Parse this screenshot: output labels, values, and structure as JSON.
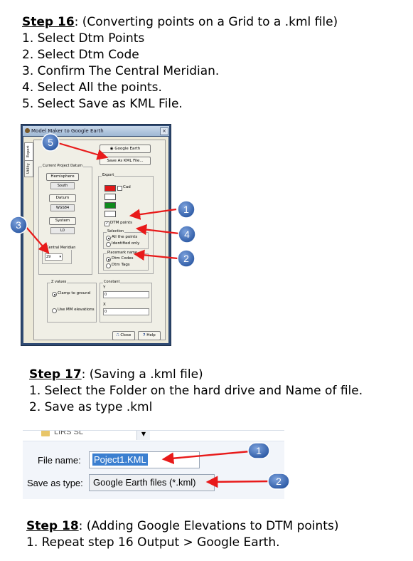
{
  "step16": {
    "title": "Step 16",
    "subtitle": ": (Converting points on a Grid to a .kml file)",
    "items": [
      "1.  Select Dtm Points",
      "2.  Select Dtm Code",
      "3.  Confirm The Central Meridian.",
      "4.  Select All the points.",
      "5.  Select Save as KML File."
    ]
  },
  "window": {
    "title": "Model Maker to Google Earth",
    "tabs": [
      "Export",
      "Utility"
    ],
    "google_earth_button": "Google Earth",
    "save_kml_button": "Save As KML File...",
    "current_datum_group": "Current Project Datum",
    "hemisphere_label": "Hemisphere",
    "hemisphere_value": "South",
    "datum_label": "Datum",
    "datum_value": "WGS84",
    "system_label": "System",
    "system_value": "L0",
    "central_meridian_label": "Central Meridian",
    "central_meridian_value": "29",
    "export_group": "Export",
    "cad_label": "Cad",
    "dtm_points_label": "DTM points",
    "selection_group": "Selection",
    "all_points_label": "All the points",
    "identified_only_label": "Identified only",
    "placemark_group": "Placemark name",
    "dtm_codes_label": "Dtm Codes",
    "dtm_tags_label": "Dtm Tags",
    "zvalues_group": "Z values",
    "clamp_label": "Clamp to ground",
    "use_mm_label": "Use MM elevations",
    "constant_group": "Constant",
    "y_label": "Y",
    "y_value": "0",
    "x_label": "X",
    "x_value": "0",
    "close_button": "Close",
    "help_button": "Help",
    "swatch_colors": [
      "#e01818",
      "#ffffff",
      "#108a1c"
    ]
  },
  "callouts16": [
    "5",
    "3",
    "1",
    "4",
    "2"
  ],
  "step17": {
    "title": "Step 17",
    "subtitle": ": (Saving a .kml file)",
    "items": [
      "1.  Select the Folder on the hard drive and Name of file.",
      "2.  Save as type .kml"
    ]
  },
  "dialog": {
    "folder_partial": "LIRS SL",
    "file_name_label": "File name:",
    "file_name_value": "Poject1.KML",
    "save_type_label": "Save as type:",
    "save_type_value": "Google Earth files (*.kml)"
  },
  "callouts17": [
    "1",
    "2"
  ],
  "step18": {
    "title": "Step 18",
    "subtitle": ": (Adding Google Elevations to DTM points)",
    "items": [
      "1.  Repeat step 16 Output > Google Earth."
    ]
  },
  "colors": {
    "callout": "#3a67b0",
    "arrow": "#e81a1a"
  }
}
